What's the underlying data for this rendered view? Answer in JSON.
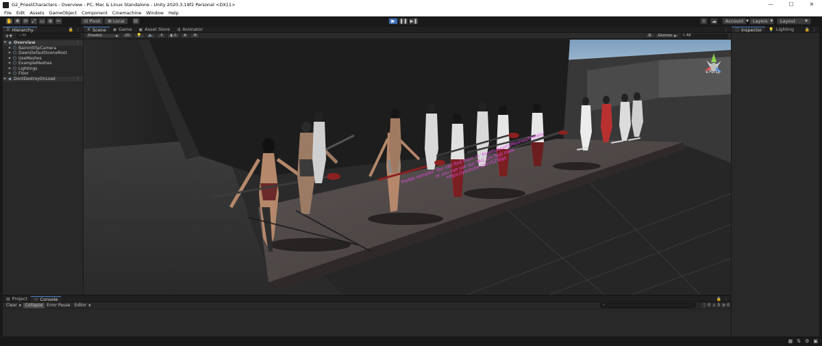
{
  "window": {
    "title": "G2_PriestCharacters - Overview - PC, Mac & Linux Standalone - Unity 2020.3.19f2 Personal <DX11>",
    "minimize": "—",
    "maximize": "☐",
    "close": "✕"
  },
  "menu": [
    "File",
    "Edit",
    "Assets",
    "GameObject",
    "Component",
    "Cinemachine",
    "Window",
    "Help"
  ],
  "toolbar": {
    "pivot": "Pivot",
    "local": "Local",
    "account": "Account",
    "layers": "Layers",
    "layout": "Layout"
  },
  "hierarchy": {
    "tab": "Hierarchy",
    "search_placeholder": "All",
    "items": [
      {
        "label": "Overview",
        "depth": 0,
        "type": "scene"
      },
      {
        "label": "BaironttSpCamera",
        "depth": 1,
        "type": "object"
      },
      {
        "label": "DawnDefaultSceneRoot",
        "depth": 1,
        "type": "object"
      },
      {
        "label": "UseMeshes",
        "depth": 1,
        "type": "object"
      },
      {
        "label": "ExampleMeshes",
        "depth": 1,
        "type": "object"
      },
      {
        "label": "Lightings",
        "depth": 1,
        "type": "object"
      },
      {
        "label": "Floor",
        "depth": 1,
        "type": "object"
      },
      {
        "label": "DontDestroyOnLoad",
        "depth": 0,
        "type": "scene"
      }
    ]
  },
  "scene_tabs": [
    {
      "label": "Scene",
      "icon": "#",
      "active": true
    },
    {
      "label": "Game",
      "icon": "◉",
      "active": false
    },
    {
      "label": "Asset Store",
      "icon": "▣",
      "active": false
    },
    {
      "label": "Animator",
      "icon": "⇶",
      "active": false
    }
  ],
  "scene_bar": {
    "shading": "Shaded",
    "mode2d": "2D",
    "fx_count": "0",
    "gizmos": "Gizmos",
    "search_placeholder": "All"
  },
  "viewport": {
    "persp": "Persp",
    "sign_lines": [
      "Prefab samples. You can find them in 'Assets/AssetsMeshes/Prefabs'",
      "or you can use our TAG (ch:Tag) code",
      "https://youtube.com/G2Tags"
    ]
  },
  "inspector": {
    "tabs": [
      {
        "label": "Inspector",
        "icon": "ⓘ",
        "active": true
      },
      {
        "label": "Lighting",
        "icon": "💡",
        "active": false
      }
    ]
  },
  "console": {
    "tabs": [
      {
        "label": "Project",
        "icon": "▤",
        "active": false
      },
      {
        "label": "Console",
        "icon": "▭",
        "active": true
      }
    ],
    "clear": "Clear",
    "collapse": "Collapse",
    "error_pause": "Error Pause",
    "editor": "Editor",
    "search_placeholder": "",
    "count_info": "0",
    "count_warn": "0",
    "count_error": "0"
  },
  "colors": {
    "accent_blue": "#3a6db5",
    "sign_text": "#e24adf",
    "background": "#191919"
  }
}
